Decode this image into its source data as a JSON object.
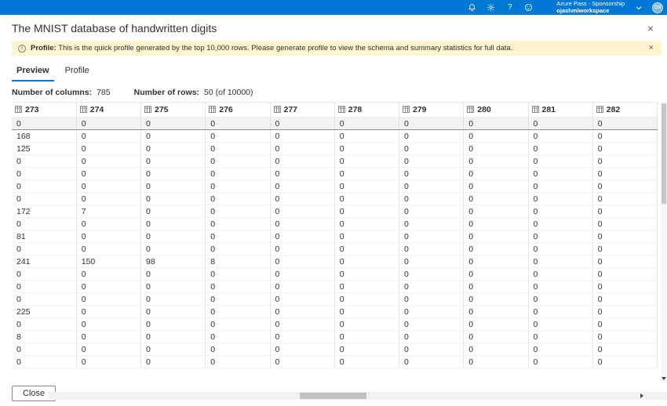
{
  "topbar": {
    "subscription": "Azure Pass - Sponsorship",
    "workspace": "ojashmlworkspace",
    "avatar": "OS"
  },
  "icons": {
    "close": "×",
    "info": "i",
    "help": "?"
  },
  "panel": {
    "title": "The MNIST database of handwritten digits"
  },
  "banner": {
    "label": "Profile:",
    "message": "This is the quick profile generated by the top 10,000 rows. Please generate profile to view the schema and summary statistics for full data."
  },
  "tabs": {
    "preview": "Preview",
    "profile": "Profile"
  },
  "stats": {
    "columns_label": "Number of columns:",
    "columns_value": "785",
    "rows_label": "Number of rows:",
    "rows_value": "50 (of 10000)"
  },
  "table": {
    "columns": [
      "273",
      "274",
      "275",
      "276",
      "277",
      "278",
      "279",
      "280",
      "281",
      "282"
    ],
    "rows": [
      [
        0,
        0,
        0,
        0,
        0,
        0,
        0,
        0,
        0,
        0
      ],
      [
        168,
        0,
        0,
        0,
        0,
        0,
        0,
        0,
        0,
        0
      ],
      [
        125,
        0,
        0,
        0,
        0,
        0,
        0,
        0,
        0,
        0
      ],
      [
        0,
        0,
        0,
        0,
        0,
        0,
        0,
        0,
        0,
        0
      ],
      [
        0,
        0,
        0,
        0,
        0,
        0,
        0,
        0,
        0,
        0
      ],
      [
        0,
        0,
        0,
        0,
        0,
        0,
        0,
        0,
        0,
        0
      ],
      [
        0,
        0,
        0,
        0,
        0,
        0,
        0,
        0,
        0,
        0
      ],
      [
        172,
        7,
        0,
        0,
        0,
        0,
        0,
        0,
        0,
        0
      ],
      [
        0,
        0,
        0,
        0,
        0,
        0,
        0,
        0,
        0,
        0
      ],
      [
        81,
        0,
        0,
        0,
        0,
        0,
        0,
        0,
        0,
        0
      ],
      [
        0,
        0,
        0,
        0,
        0,
        0,
        0,
        0,
        0,
        0
      ],
      [
        241,
        150,
        98,
        8,
        0,
        0,
        0,
        0,
        0,
        0
      ],
      [
        0,
        0,
        0,
        0,
        0,
        0,
        0,
        0,
        0,
        0
      ],
      [
        0,
        0,
        0,
        0,
        0,
        0,
        0,
        0,
        0,
        0
      ],
      [
        0,
        0,
        0,
        0,
        0,
        0,
        0,
        0,
        0,
        0
      ],
      [
        225,
        0,
        0,
        0,
        0,
        0,
        0,
        0,
        0,
        0
      ],
      [
        0,
        0,
        0,
        0,
        0,
        0,
        0,
        0,
        0,
        0
      ],
      [
        8,
        0,
        0,
        0,
        0,
        0,
        0,
        0,
        0,
        0
      ],
      [
        0,
        0,
        0,
        0,
        0,
        0,
        0,
        0,
        0,
        0
      ],
      [
        0,
        0,
        0,
        0,
        0,
        0,
        0,
        0,
        0,
        0
      ]
    ]
  },
  "footer": {
    "close_button": "Close"
  }
}
